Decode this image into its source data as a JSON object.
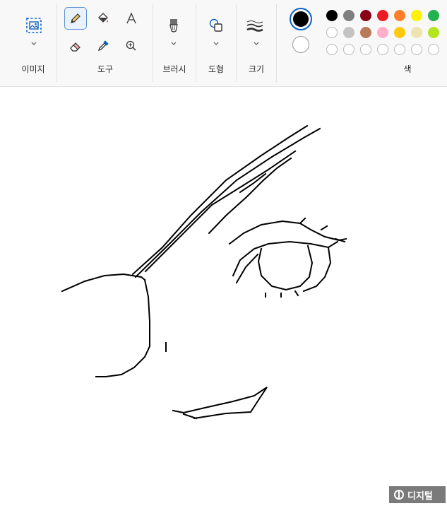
{
  "groups": {
    "image": "이미지",
    "tools": "도구",
    "brush": "브러시",
    "shapes": "도형",
    "size": "크기",
    "colors": "색"
  },
  "colors": {
    "primary": "#000000",
    "secondary": "#ffffff",
    "accent": "#0a64c8",
    "palette_row1": [
      "#000000",
      "#7f7f7f",
      "#880015",
      "#ed1c24",
      "#ff7f27",
      "#fff200",
      "#22b14c"
    ],
    "palette_row2": [
      "#ffffff",
      "#c3c3c3",
      "#b97a57",
      "#ffaec9",
      "#ffc90e",
      "#efe4b0",
      "#b5e61d"
    ]
  },
  "icons": {
    "select": "image-select-icon",
    "pencil": "pencil-icon",
    "fill": "fill-bucket-icon",
    "text": "text-icon",
    "eraser": "eraser-icon",
    "picker": "color-picker-icon",
    "magnifier": "magnifier-icon",
    "brush": "brush-icon",
    "shapes": "shapes-icon",
    "size": "size-lines-icon"
  },
  "watermark": {
    "text": "디지털"
  }
}
